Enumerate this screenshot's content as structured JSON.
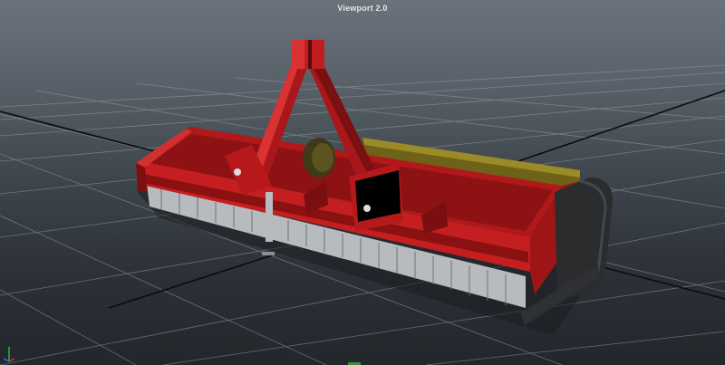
{
  "viewport": {
    "title": "Viewport 2.0"
  },
  "model": {
    "name": "flail-mower",
    "colors": {
      "body": "#b1181a",
      "body_dark": "#6d0c0d",
      "body_highlight": "#d83232",
      "skirt": "#c8cacc",
      "shaft": "#7a6a1a",
      "guard": "#2a2c2e"
    }
  },
  "axis": {
    "x_color": "#e03030",
    "y_color": "#30c030",
    "z_color": "#3070e0"
  }
}
